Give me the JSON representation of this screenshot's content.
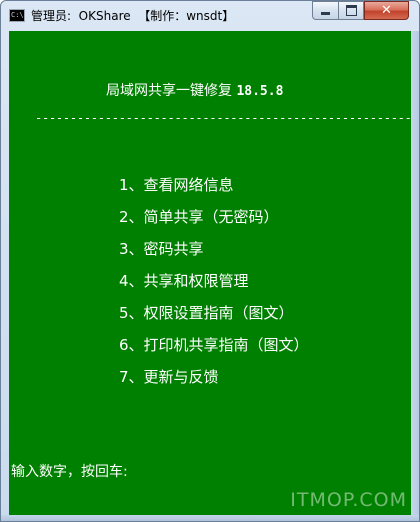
{
  "window": {
    "title": "管理员:  OKShare  【制作：wnsdt】",
    "icon_text": "C:\\",
    "icons": {
      "app": "console-icon",
      "minimize": "minimize-icon",
      "maximize": "maximize-icon",
      "close": "close-icon"
    },
    "colors": {
      "console_background": "#008000",
      "console_text": "#ffffff"
    }
  },
  "console": {
    "heading": "局域网共享一键修复",
    "version": "18.5.8",
    "separator": "---------------------------------------------------------",
    "menu": [
      "1、查看网络信息",
      "2、简单共享（无密码）",
      "3、密码共享",
      "4、共享和权限管理",
      "5、权限设置指南（图文）",
      "6、打印机共享指南（图文）",
      "7、更新与反馈"
    ],
    "prompt": "输入数字，按回车:"
  },
  "watermark": "ITMOP.COM"
}
